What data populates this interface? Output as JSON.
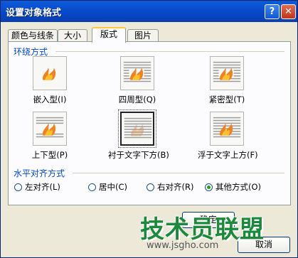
{
  "window": {
    "title": "设置对象格式"
  },
  "tabs": [
    "颜色与线条",
    "大小",
    "版式",
    "图片"
  ],
  "wrap": {
    "label": "环绕方式",
    "options": [
      {
        "label": "嵌入型(I)",
        "icon": "inline-wrap-icon"
      },
      {
        "label": "四周型(Q)",
        "icon": "square-wrap-icon"
      },
      {
        "label": "紧密型(T)",
        "icon": "tight-wrap-icon"
      },
      {
        "label": "上下型(P)",
        "icon": "top-bottom-wrap-icon"
      },
      {
        "label": "衬于文字下方(B)",
        "icon": "behind-text-icon",
        "selected": true
      },
      {
        "label": "浮于文字上方(F)",
        "icon": "in-front-text-icon"
      }
    ]
  },
  "align": {
    "label": "水平对齐方式",
    "options": [
      {
        "label": "左对齐(L)",
        "checked": false
      },
      {
        "label": "居中(C)",
        "checked": false
      },
      {
        "label": "右对齐(R)",
        "checked": false
      },
      {
        "label": "其他方式(O)",
        "checked": true
      }
    ]
  },
  "buttons": {
    "ok": "确定",
    "cancel": "取消"
  },
  "watermark": {
    "text": "技术员联盟",
    "url": "www.jsgho.com"
  },
  "colors": {
    "title_bar": "#0a4fd0",
    "group_label": "#0046d5",
    "watermark": "#1a8a3a",
    "checked_dot": "#21a121"
  }
}
